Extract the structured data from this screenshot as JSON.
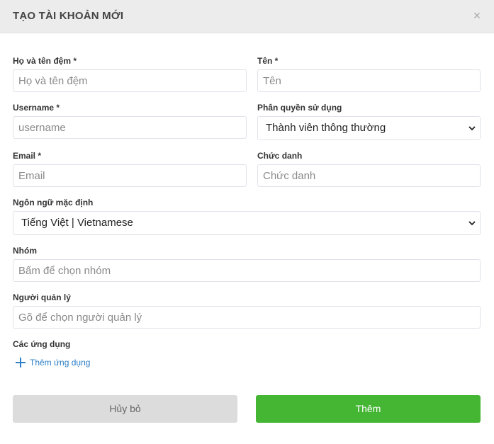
{
  "header": {
    "title": "TẠO TÀI KHOẢN MỚI",
    "close_symbol": "×"
  },
  "form": {
    "middle_name": {
      "label": "Họ và tên đệm *",
      "placeholder": "Họ và tên đệm"
    },
    "first_name": {
      "label": "Tên *",
      "placeholder": "Tên"
    },
    "username": {
      "label": "Username *",
      "placeholder": "username"
    },
    "role": {
      "label": "Phân quyền sử dụng",
      "value": "Thành viên thông thường"
    },
    "email": {
      "label": "Email *",
      "placeholder": "Email"
    },
    "job_title": {
      "label": "Chức danh",
      "placeholder": "Chức danh"
    },
    "language": {
      "label": "Ngôn ngữ mặc định",
      "value": "Tiếng Việt | Vietnamese"
    },
    "group": {
      "label": "Nhóm",
      "placeholder": "Bấm để chọn nhóm"
    },
    "manager": {
      "label": "Người quản lý",
      "placeholder": "Gõ để chọn người quản lý"
    },
    "apps": {
      "label": "Các ứng dụng",
      "add_label": "Thêm ứng dụng"
    }
  },
  "actions": {
    "cancel_label": "Hủy bỏ",
    "submit_label": "Thêm"
  },
  "colors": {
    "accent": "#2d7fc6",
    "primary_button": "#45b534",
    "cancel_button": "#dcdcdc",
    "header_bg": "#ececec"
  },
  "icons": {
    "close": "close-icon",
    "chevron": "chevron-down-icon",
    "plus": "plus-icon"
  }
}
